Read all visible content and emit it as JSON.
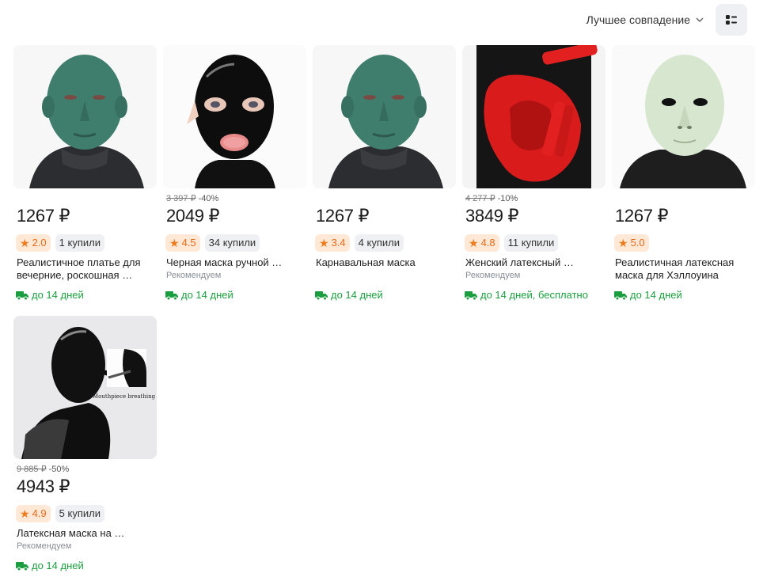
{
  "sort": {
    "label": "Лучшее совпадение"
  },
  "products": [
    {
      "price": "1267 ₽",
      "old_price": "",
      "discount": "",
      "rating": "2.0",
      "bought": "1 купили",
      "title": "Реалистичное платье для вечерние, роскошная …",
      "recommended": "",
      "delivery": "до 14 дней",
      "image": "green-face-mask"
    },
    {
      "price": "2049 ₽",
      "old_price": "3 397 ₽",
      "discount": "-40%",
      "rating": "4.5",
      "bought": "34 купили",
      "title": "Черная маска ручной …",
      "recommended": "Рекомендуем",
      "delivery": "до 14 дней",
      "image": "black-latex-hood"
    },
    {
      "price": "1267 ₽",
      "old_price": "",
      "discount": "",
      "rating": "3.4",
      "bought": "4 купили",
      "title": "Карнавальная маска",
      "recommended": "",
      "delivery": "до 14 дней",
      "image": "green-face-mask"
    },
    {
      "price": "3849 ₽",
      "old_price": "4 277 ₽",
      "discount": "-10%",
      "rating": "4.8",
      "bought": "11 купили",
      "title": "Женский латексный …",
      "recommended": "Рекомендуем",
      "delivery": "до 14 дней, бесплатно",
      "image": "red-mouthpiece"
    },
    {
      "price": "1267 ₽",
      "old_price": "",
      "discount": "",
      "rating": "5.0",
      "bought": "",
      "title": "Реалистичная латексная маска для Хэллоуина",
      "recommended": "",
      "delivery": "до 14 дней",
      "image": "pale-face-mask"
    },
    {
      "price": "4943 ₽",
      "old_price": "9 885 ₽",
      "discount": "-50%",
      "rating": "4.9",
      "bought": "5 купили",
      "title": "Латексная маска на …",
      "recommended": "Рекомендуем",
      "delivery": "до 14 дней",
      "image": "black-hood-breathing-tube",
      "image_caption": "Mouthpiece breathing tube"
    }
  ],
  "colors": {
    "rating_bg": "#ffe8d6",
    "rating_fg": "#e56a18",
    "delivery": "#1a9e3f",
    "card_bg": "#f2f3f5"
  }
}
